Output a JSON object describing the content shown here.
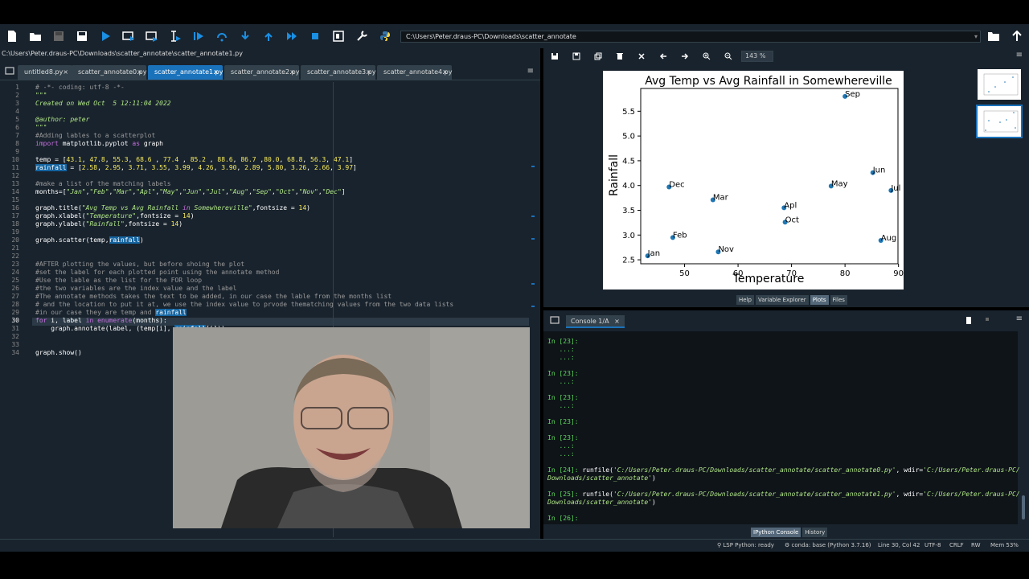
{
  "toolbar": {
    "path": "C:\\Users\\Peter.draus-PC\\Downloads\\scatter_annotate"
  },
  "editor": {
    "file_path": "C:\\Users\\Peter.draus-PC\\Downloads\\scatter_annotate\\scatter_annotate1.py",
    "tabs": [
      {
        "label": "untitled8.py",
        "active": false
      },
      {
        "label": "scatter_annotate0.py",
        "active": false
      },
      {
        "label": "scatter_annotate1.py",
        "active": true
      },
      {
        "label": "scatter_annotate2.py",
        "active": false
      },
      {
        "label": "scatter_annotate3.py",
        "active": false
      },
      {
        "label": "scatter_annotate4.py",
        "active": false
      }
    ],
    "tab_close": "×",
    "code_lines": [
      "# -*- coding: utf-8 -*-",
      "\"\"\"",
      "Created on Wed Oct  5 12:11:04 2022",
      "",
      "@author: peter",
      "\"\"\"",
      "#Adding lables to a scatterplot",
      "import matplotlib.pyplot as graph",
      "",
      "temp = [43.1, 47.8, 55.3, 68.6 , 77.4 , 85.2 , 88.6, 86.7 ,80.0, 68.8, 56.3, 47.1]",
      "rainfall = [2.58, 2.95, 3.71, 3.55, 3.99, 4.26, 3.90, 2.89, 5.80, 3.26, 2.66, 3.97]",
      "",
      "#make a list of the matching labels",
      "months=[\"Jan\",\"Feb\",\"Mar\",\"Apl\",\"May\",\"Jun\",\"Jul\",\"Aug\",\"Sep\",\"Oct\",\"Nov\",\"Dec\"]",
      "",
      "graph.title(\"Avg Temp vs Avg Rainfall in Somewhereville\",fontsize = 14)",
      "graph.xlabel(\"Temperature\",fontsize = 14)",
      "graph.ylabel(\"Rainfall\",fontsize = 14)",
      "",
      "graph.scatter(temp,rainfall)",
      "",
      "",
      "#AFTER plotting the values, but before shoing the plot",
      "#set the label for each plotted point using the annotate method",
      "#Use the lable as the list for the FOR loop",
      "#the two variables are the index value and the label",
      "#The annotate methods takes the text to be added, in our case the lable from the months list",
      "# and the location to put it at, we use the index value to prvode thematching values from the two data lists",
      "#in our case they are temp and rainfall",
      "for i, label in enumerate(months):",
      "    graph.annotate(label, (temp[i], rainfall[i]))",
      "",
      "",
      "graph.show()"
    ]
  },
  "plots": {
    "zoom": "143 %",
    "tabs": [
      "Help",
      "Variable Explorer",
      "Plots",
      "Files"
    ],
    "active_tab": "Plots"
  },
  "chart_data": {
    "type": "scatter",
    "title": "Avg Temp vs Avg Rainfall in Somewhereville",
    "xlabel": "Temperature",
    "ylabel": "Rainfall",
    "xlim": [
      41.8,
      89.9
    ],
    "ylim": [
      2.42,
      5.96
    ],
    "xticks": [
      50,
      60,
      70,
      80,
      90
    ],
    "yticks": [
      2.5,
      3.0,
      3.5,
      4.0,
      4.5,
      5.0,
      5.5
    ],
    "xtick_labels": [
      "50",
      "60",
      "70",
      "80",
      "90"
    ],
    "ytick_labels": [
      "2.5",
      "3.0",
      "3.5",
      "4.0",
      "4.5",
      "5.0",
      "5.5"
    ],
    "points": [
      {
        "label": "Jan",
        "x": 43.1,
        "y": 2.58
      },
      {
        "label": "Feb",
        "x": 47.8,
        "y": 2.95
      },
      {
        "label": "Mar",
        "x": 55.3,
        "y": 3.71
      },
      {
        "label": "Apl",
        "x": 68.6,
        "y": 3.55
      },
      {
        "label": "May",
        "x": 77.4,
        "y": 3.99
      },
      {
        "label": "Jun",
        "x": 85.2,
        "y": 4.26
      },
      {
        "label": "Jul",
        "x": 88.6,
        "y": 3.9
      },
      {
        "label": "Aug",
        "x": 86.7,
        "y": 2.89
      },
      {
        "label": "Sep",
        "x": 80.0,
        "y": 5.8
      },
      {
        "label": "Oct",
        "x": 68.8,
        "y": 3.26
      },
      {
        "label": "Nov",
        "x": 56.3,
        "y": 2.66
      },
      {
        "label": "Dec",
        "x": 47.1,
        "y": 3.97
      }
    ],
    "color": "#1f77b4"
  },
  "console": {
    "tab_label": "Console 1/A",
    "tab_close": "×",
    "lines": [
      {
        "kind": "prompt",
        "text": "In [23]:"
      },
      {
        "kind": "cont",
        "text": "   ...:"
      },
      {
        "kind": "cont",
        "text": "   ...:"
      },
      {
        "kind": "blank",
        "text": ""
      },
      {
        "kind": "prompt",
        "text": "In [23]:"
      },
      {
        "kind": "cont",
        "text": "   ...:"
      },
      {
        "kind": "blank",
        "text": ""
      },
      {
        "kind": "prompt",
        "text": "In [23]:"
      },
      {
        "kind": "cont",
        "text": "   ...:"
      },
      {
        "kind": "blank",
        "text": ""
      },
      {
        "kind": "prompt",
        "text": "In [23]:"
      },
      {
        "kind": "blank",
        "text": ""
      },
      {
        "kind": "prompt",
        "text": "In [23]:"
      },
      {
        "kind": "cont",
        "text": "   ...:"
      },
      {
        "kind": "cont",
        "text": "   ...:"
      },
      {
        "kind": "blank",
        "text": ""
      },
      {
        "kind": "run",
        "prompt": "In [24]:",
        "text": "runfile(",
        "arg1": "'C:/Users/Peter.draus-PC/Downloads/scatter_annotate/scatter_annotate0.py'",
        "mid": ", wdir=",
        "arg2": "'C:/Users/Peter.draus-PC/"
      },
      {
        "kind": "runcont",
        "text": "Downloads/scatter_annotate'",
        "tail": ")"
      },
      {
        "kind": "blank",
        "text": ""
      },
      {
        "kind": "run",
        "prompt": "In [25]:",
        "text": "runfile(",
        "arg1": "'C:/Users/Peter.draus-PC/Downloads/scatter_annotate/scatter_annotate1.py'",
        "mid": ", wdir=",
        "arg2": "'C:/Users/Peter.draus-PC/"
      },
      {
        "kind": "runcont",
        "text": "Downloads/scatter_annotate'",
        "tail": ")"
      },
      {
        "kind": "blank",
        "text": ""
      },
      {
        "kind": "prompt",
        "text": "In [26]:"
      }
    ],
    "tabs": [
      "IPython Console",
      "History"
    ],
    "active_tab": "IPython Console"
  },
  "status": {
    "lsp": "LSP Python: ready",
    "conda": "conda: base (Python 3.7.16)",
    "position": "Line 30, Col 42",
    "encoding": "UTF-8",
    "eol": "CRLF",
    "rw": "RW",
    "mem": "Mem 53%"
  }
}
